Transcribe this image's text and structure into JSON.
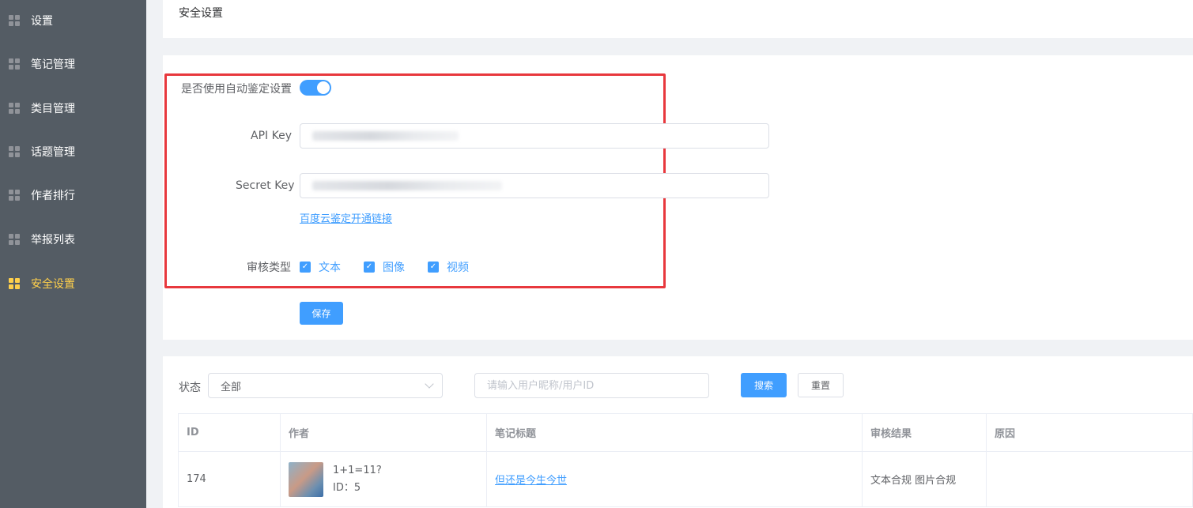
{
  "sidebar": {
    "items": [
      {
        "label": "设置",
        "icon": "grid-icon",
        "active": false
      },
      {
        "label": "笔记管理",
        "icon": "grid-icon",
        "active": false
      },
      {
        "label": "类目管理",
        "icon": "grid-icon",
        "active": false
      },
      {
        "label": "话题管理",
        "icon": "grid-icon",
        "active": false
      },
      {
        "label": "作者排行",
        "icon": "grid-icon",
        "active": false
      },
      {
        "label": "举报列表",
        "icon": "grid-icon",
        "active": false
      },
      {
        "label": "安全设置",
        "icon": "grid-icon",
        "active": true
      }
    ]
  },
  "header": {
    "title": "安全设置"
  },
  "form": {
    "auto_review_label": "是否使用自动鉴定设置",
    "auto_review_enabled": true,
    "api_key_label": "API Key",
    "secret_key_label": "Secret Key",
    "baidu_link": "百度云鉴定开通链接",
    "review_type_label": "审核类型",
    "review_types": [
      {
        "label": "文本",
        "checked": true
      },
      {
        "label": "图像",
        "checked": true
      },
      {
        "label": "视频",
        "checked": true
      }
    ],
    "save_label": "保存"
  },
  "filters": {
    "status_label": "状态",
    "status_value": "全部",
    "search_placeholder": "请输入用户昵称/用户ID",
    "search_label": "搜索",
    "reset_label": "重置"
  },
  "table": {
    "columns": [
      "ID",
      "作者",
      "笔记标题",
      "审核结果",
      "原因"
    ],
    "rows": [
      {
        "id": "174",
        "author_name": "1+1=11?",
        "author_id": "ID：5",
        "title": "但还是今生今世",
        "result": "文本合规 图片合规",
        "reason": ""
      }
    ]
  },
  "colors": {
    "primary": "#409eff",
    "sidebar_bg": "#545c64",
    "active": "#ffd04b",
    "highlight": "#e8383d"
  }
}
